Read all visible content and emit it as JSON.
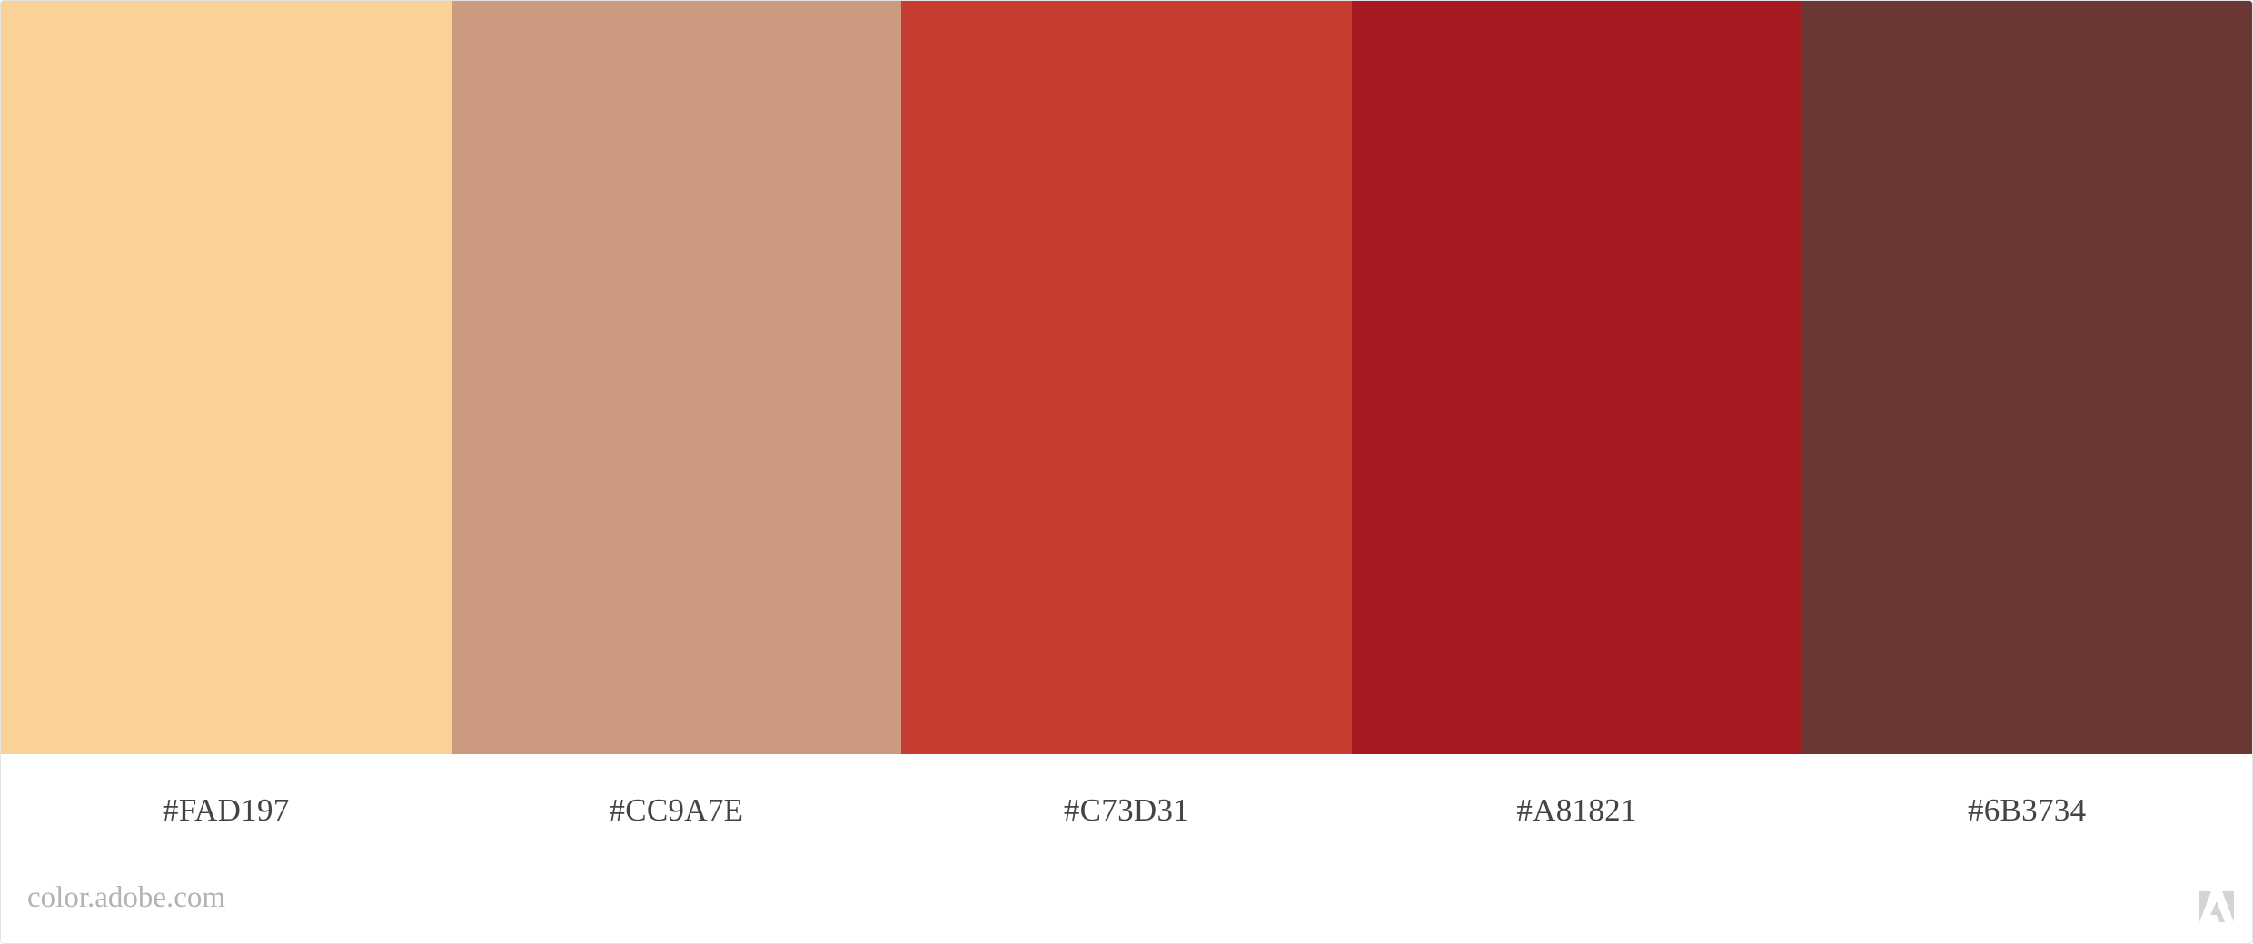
{
  "palette": {
    "swatches": [
      {
        "hex": "#FAD197",
        "color": "#FAD197"
      },
      {
        "hex": "#CC9A7E",
        "color": "#CC9A7E"
      },
      {
        "hex": "#C73D31",
        "color": "#C73D31"
      },
      {
        "hex": "#A81821",
        "color": "#A81821"
      },
      {
        "hex": "#6B3734",
        "color": "#6B3734"
      }
    ]
  },
  "footer": {
    "site": "color.adobe.com",
    "logo_icon": "adobe-logo-icon",
    "logo_color": "#d4d4d4"
  }
}
